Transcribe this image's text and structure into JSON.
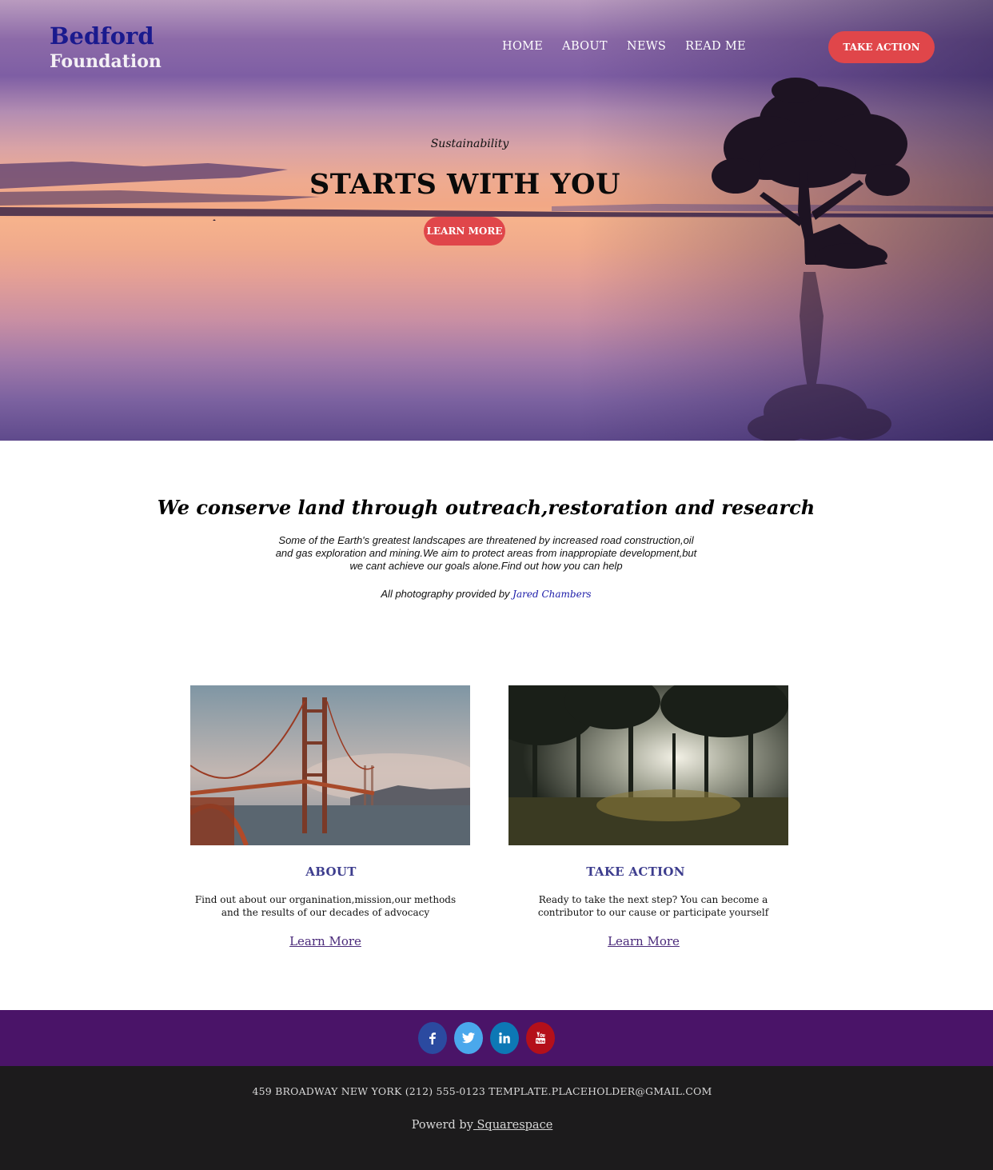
{
  "header": {
    "logo_line1": "Bedford",
    "logo_line2": "Foundation",
    "nav": [
      "HOME",
      "ABOUT",
      "NEWS",
      "READ ME"
    ],
    "cta_label": "TAKE ACTION"
  },
  "hero": {
    "kicker": "Sustainability",
    "title": "STARTS WITH YOU",
    "button_label": "LEARN MORE"
  },
  "intro": {
    "heading": "We conserve land through outreach,restoration and research",
    "body": "Some of the Earth's greatest landscapes are threatened by increased road construction,oil and gas exploration and mining.We aim to protect areas from inappropiate development,but we cant achieve our goals alone.Find out how you can help",
    "credit_prefix": "All photography provided by ",
    "credit_name": "Jared Chambers"
  },
  "cards": [
    {
      "title": "ABOUT",
      "text": "Find out about our organination,mission,our methods and the results of our decades of advocacy",
      "link": "Learn More"
    },
    {
      "title": "TAKE ACTION",
      "text": "Ready to take the next step? You can become a contributor to our cause or participate yourself",
      "link": "Learn More"
    }
  ],
  "social": [
    {
      "icon": "facebook-icon",
      "color": "#2b4aa0"
    },
    {
      "icon": "twitter-icon",
      "color": "#4aa8ec"
    },
    {
      "icon": "linkedin-icon",
      "color": "#0d78b5"
    },
    {
      "icon": "youtube-icon",
      "color": "#b4101a"
    }
  ],
  "footer": {
    "contact": "459 BROADWAY NEW YORK (212) 555-0123 TEMPLATE.PLACEHOLDER@GMAIL.COM",
    "powered_prefix": "Powerd by",
    "powered_link": " Squarespace"
  },
  "colors": {
    "accent": "#e0464a",
    "brand_navy": "#1a1a8e",
    "social_bar": "#4a1468",
    "footer_bg": "#1c1b1c"
  }
}
